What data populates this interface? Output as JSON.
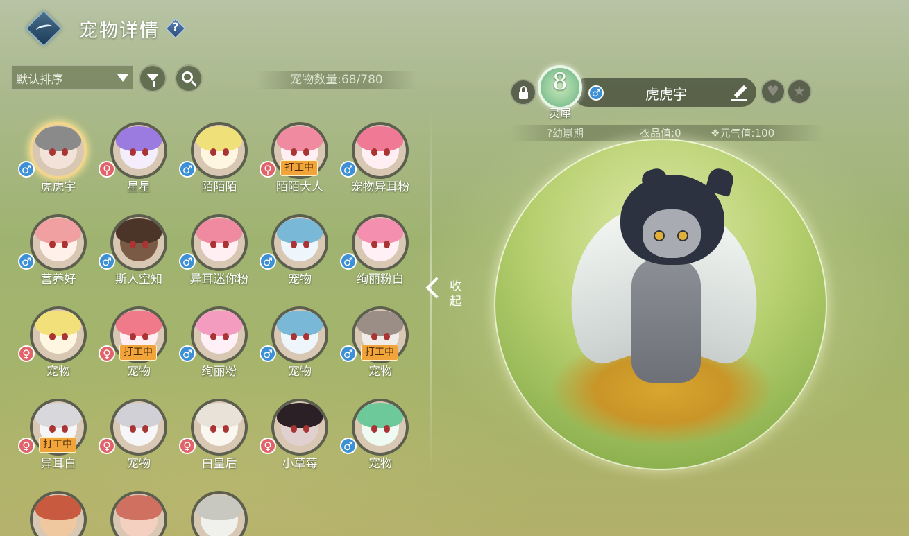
{
  "header": {
    "title": "宠物详情",
    "help_label": "?"
  },
  "toolbar": {
    "sort_value": "默认排序",
    "pet_count": "宠物数量:68/780"
  },
  "pets": [
    {
      "name": "虎虎宇",
      "gender": "♂",
      "working": false,
      "selected": true
    },
    {
      "name": "星星",
      "gender": "♀",
      "working": false
    },
    {
      "name": "陌陌陌",
      "gender": "♂",
      "working": false
    },
    {
      "name": "陌陌大人",
      "gender": "♀",
      "working": true
    },
    {
      "name": "宠物异耳粉",
      "gender": "♂",
      "working": false
    },
    {
      "name": "营养好",
      "gender": "♂",
      "working": false
    },
    {
      "name": "斯人空知",
      "gender": "♂",
      "working": false
    },
    {
      "name": "异耳迷你粉",
      "gender": "♂",
      "working": false
    },
    {
      "name": "宠物",
      "gender": "♂",
      "working": false
    },
    {
      "name": "绚丽粉白",
      "gender": "♂",
      "working": false
    },
    {
      "name": "宠物",
      "gender": "♀",
      "working": false
    },
    {
      "name": "宠物",
      "gender": "♀",
      "working": true
    },
    {
      "name": "绚丽粉",
      "gender": "♂",
      "working": false
    },
    {
      "name": "宠物",
      "gender": "♂",
      "working": false
    },
    {
      "name": "宠物",
      "gender": "♂",
      "working": true
    },
    {
      "name": "异耳白",
      "gender": "♀",
      "working": true
    },
    {
      "name": "宠物",
      "gender": "♀",
      "working": false
    },
    {
      "name": "白皇后",
      "gender": "♀",
      "working": false
    },
    {
      "name": "小草莓",
      "gender": "♀",
      "working": false
    },
    {
      "name": "宠物",
      "gender": "♂",
      "working": false
    }
  ],
  "work_badge": "打工中",
  "collapse_label": "收起",
  "detail": {
    "level": "8",
    "level_title": "灵犀",
    "gender": "♂",
    "name": "虎虎宇",
    "stage": "?幼崽期",
    "clothes": "衣品值:0",
    "vitality": "❖元气值:100"
  },
  "icons": {
    "fav": "heart-icon",
    "star": "star-icon",
    "lock": "lock-icon",
    "edit": "edit-icon"
  },
  "colors": {
    "male": "#3d8fd6",
    "female": "#e0646a",
    "work": "#f0a43a"
  }
}
